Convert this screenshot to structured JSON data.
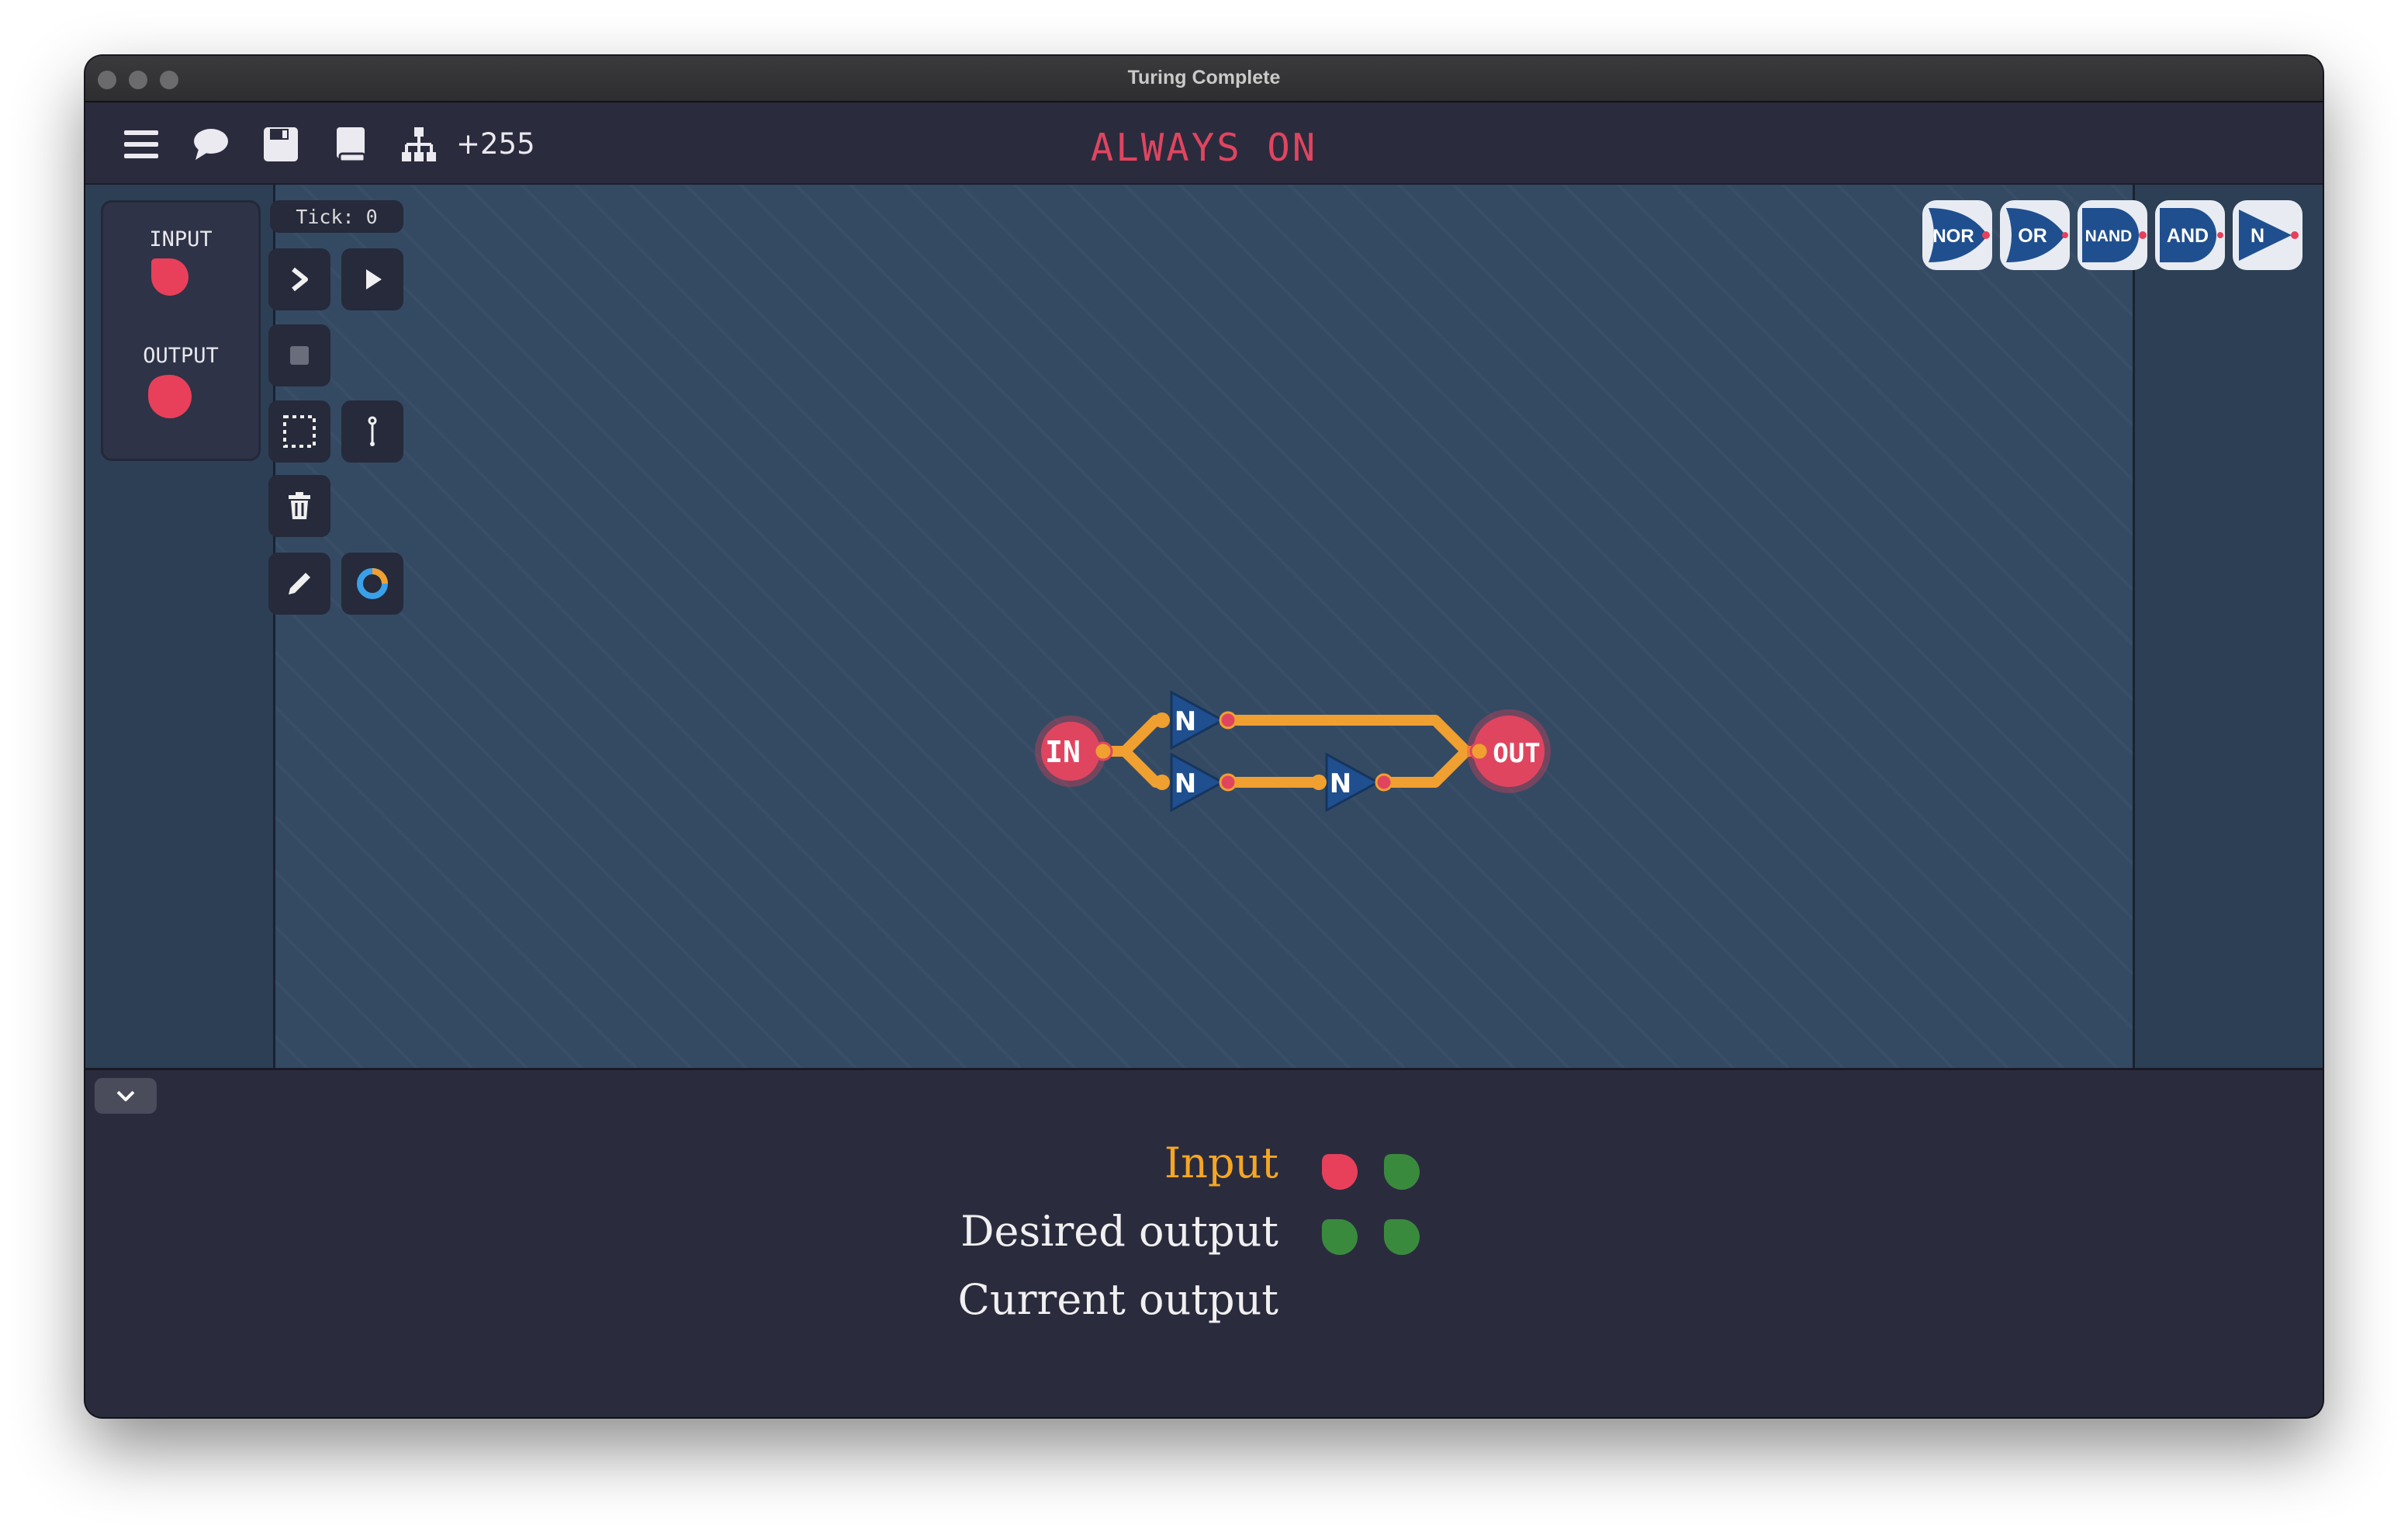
{
  "window": {
    "title": "Turing Complete"
  },
  "toolbar": {
    "icons": [
      "menu-icon",
      "chat-icon",
      "save-icon",
      "book-icon",
      "hierarchy-icon"
    ],
    "count": "+255",
    "level_title": "ALWAYS ON"
  },
  "io_panel": {
    "input_label": "INPUT",
    "output_label": "OUTPUT"
  },
  "tick": "Tick: 0",
  "tools": [
    "step-icon",
    "play-icon",
    "stop-icon",
    "select-icon",
    "wire-icon",
    "delete-icon",
    "pencil-icon",
    "color-ring-icon"
  ],
  "gate_palette": [
    {
      "label": "NOR"
    },
    {
      "label": "OR"
    },
    {
      "label": "NAND"
    },
    {
      "label": "AND"
    },
    {
      "label": "N"
    }
  ],
  "circuit": {
    "input_node": "IN",
    "output_node": "OUT",
    "gates": [
      "N",
      "N",
      "N"
    ]
  },
  "test_table": {
    "rows": [
      {
        "label": "Input",
        "values": [
          "red",
          "green"
        ]
      },
      {
        "label": "Desired output",
        "values": [
          "green",
          "green"
        ]
      },
      {
        "label": "Current output",
        "values": []
      }
    ]
  },
  "colors": {
    "accent_red": "#e0455f",
    "signal_green": "#3a8a3e",
    "wire_orange": "#f0a030",
    "gate_blue": "#1f4f8f"
  }
}
